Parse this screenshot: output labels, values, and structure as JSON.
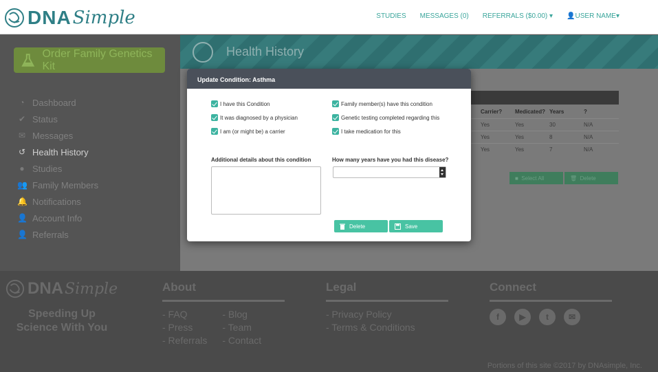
{
  "nav": {
    "logo_dna": "DNA",
    "logo_simple": "Simple",
    "links": [
      "STUDIES",
      "MESSAGES (0)",
      "REFERRALS ($0.00)"
    ],
    "user": "USER NAME"
  },
  "sidebar": {
    "order_button": "Order Family Genetics Kit",
    "items": [
      {
        "label": "Dashboard",
        "icon": "dashboard-icon"
      },
      {
        "label": "Status",
        "icon": "check-icon"
      },
      {
        "label": "Messages",
        "icon": "envelope-icon"
      },
      {
        "label": "Health History",
        "icon": "history-icon"
      },
      {
        "label": "Studies",
        "icon": "studies-icon"
      },
      {
        "label": "Family Members",
        "icon": "users-icon"
      },
      {
        "label": "Notifications",
        "icon": "bell-icon"
      },
      {
        "label": "Account Info",
        "icon": "user-icon"
      },
      {
        "label": "Referrals",
        "icon": "user-plus-icon"
      }
    ],
    "active": "Health History"
  },
  "page": {
    "title": "Health History",
    "table": {
      "columns": [
        "Carrier?",
        "Medicated?",
        "Years",
        "?"
      ],
      "rows": [
        [
          "Yes",
          "Yes",
          "30",
          "N/A"
        ],
        [
          "Yes",
          "Yes",
          "8",
          "N/A"
        ],
        [
          "Yes",
          "Yes",
          "7",
          "N/A"
        ]
      ]
    },
    "select_all": "Select All",
    "delete": "Delete"
  },
  "modal": {
    "title": "Update Condition: Asthma",
    "checks_left": [
      "I have this Condition",
      "It was diagnosed by a physician",
      "I am (or might be) a carrier"
    ],
    "checks_right": [
      "Family member(s) have this condition",
      "Genetic testing completed regarding this",
      "I take medication for this"
    ],
    "details_label": "Additional details about this condition",
    "years_label": "How many years have you had this disease?",
    "delete_button": "Delete",
    "save_button": "Save",
    "accent_color": "#48c3a3"
  },
  "footer": {
    "tagline_1": "Speeding Up",
    "tagline_2": "Science With You",
    "about_title": "About",
    "about_col1": [
      "- FAQ",
      "- Press",
      "- Referrals"
    ],
    "about_col2": [
      "- Blog",
      "- Team",
      "- Contact"
    ],
    "legal_title": "Legal",
    "legal_links": [
      "- Privacy Policy",
      "- Terms & Conditions"
    ],
    "connect_title": "Connect",
    "social": [
      "facebook-icon",
      "youtube-icon",
      "twitter-icon",
      "email-icon"
    ],
    "copyright": "Portions of this site ©2017 by DNAsimple, Inc."
  }
}
